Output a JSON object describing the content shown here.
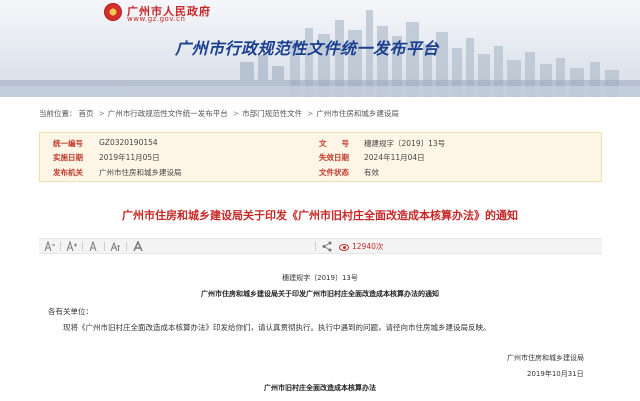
{
  "header": {
    "gov_name": "广州市人民政府",
    "gov_url": "www.gz.gov.cn",
    "platform_title": "广州市行政规范性文件统一发布平台",
    "brand_color": "#1a3f8f",
    "accent_color": "#c62828"
  },
  "breadcrumb": {
    "prefix": "当前位置：",
    "items": [
      "首页",
      "广州市行政规范性文件统一发布平台",
      "市部门规范性文件",
      "广州市住房和城乡建设局"
    ],
    "separator": ">"
  },
  "meta": {
    "unified_no_label": "统一编号",
    "unified_no": "GZ0320190154",
    "doc_no_label": "文　　号",
    "doc_no": "穗建规字〔2019〕13号",
    "effective_label": "实施日期",
    "effective_date": "2019年11月05日",
    "expire_label": "失效日期",
    "expire_date": "2024年11月04日",
    "publisher_label": "发布机关",
    "publisher": "广州市住房和城乡建设局",
    "status_label": "文件状态",
    "status": "有效"
  },
  "document": {
    "title": "广州市住房和城乡建设局关于印发《广州市旧村庄全面改造成本核算办法》的通知",
    "views": "12940次",
    "number": "穗建规字〔2019〕13号",
    "sub_title": "广州市住房和城乡建设局关于印发广州市旧村庄全面改造成本核算办法的通知",
    "salutation": "各有关单位：",
    "paragraph": "现将《广州市旧村庄全面改造成本核算办法》印发给你们，请认真贯彻执行。执行中遇到的问题，请径向市住房城乡建设局反映。",
    "issuer": "广州市住房和城乡建设局",
    "issue_date": "2019年10月31日",
    "attachment_title": "广州市旧村庄全面改造成本核算办法"
  },
  "toolbar": {
    "icons": [
      "text-decrease-icon",
      "text-increase-icon",
      "text-size-icon",
      "font-icon",
      "bold-font-icon",
      "share-icon",
      "views-icon"
    ]
  }
}
